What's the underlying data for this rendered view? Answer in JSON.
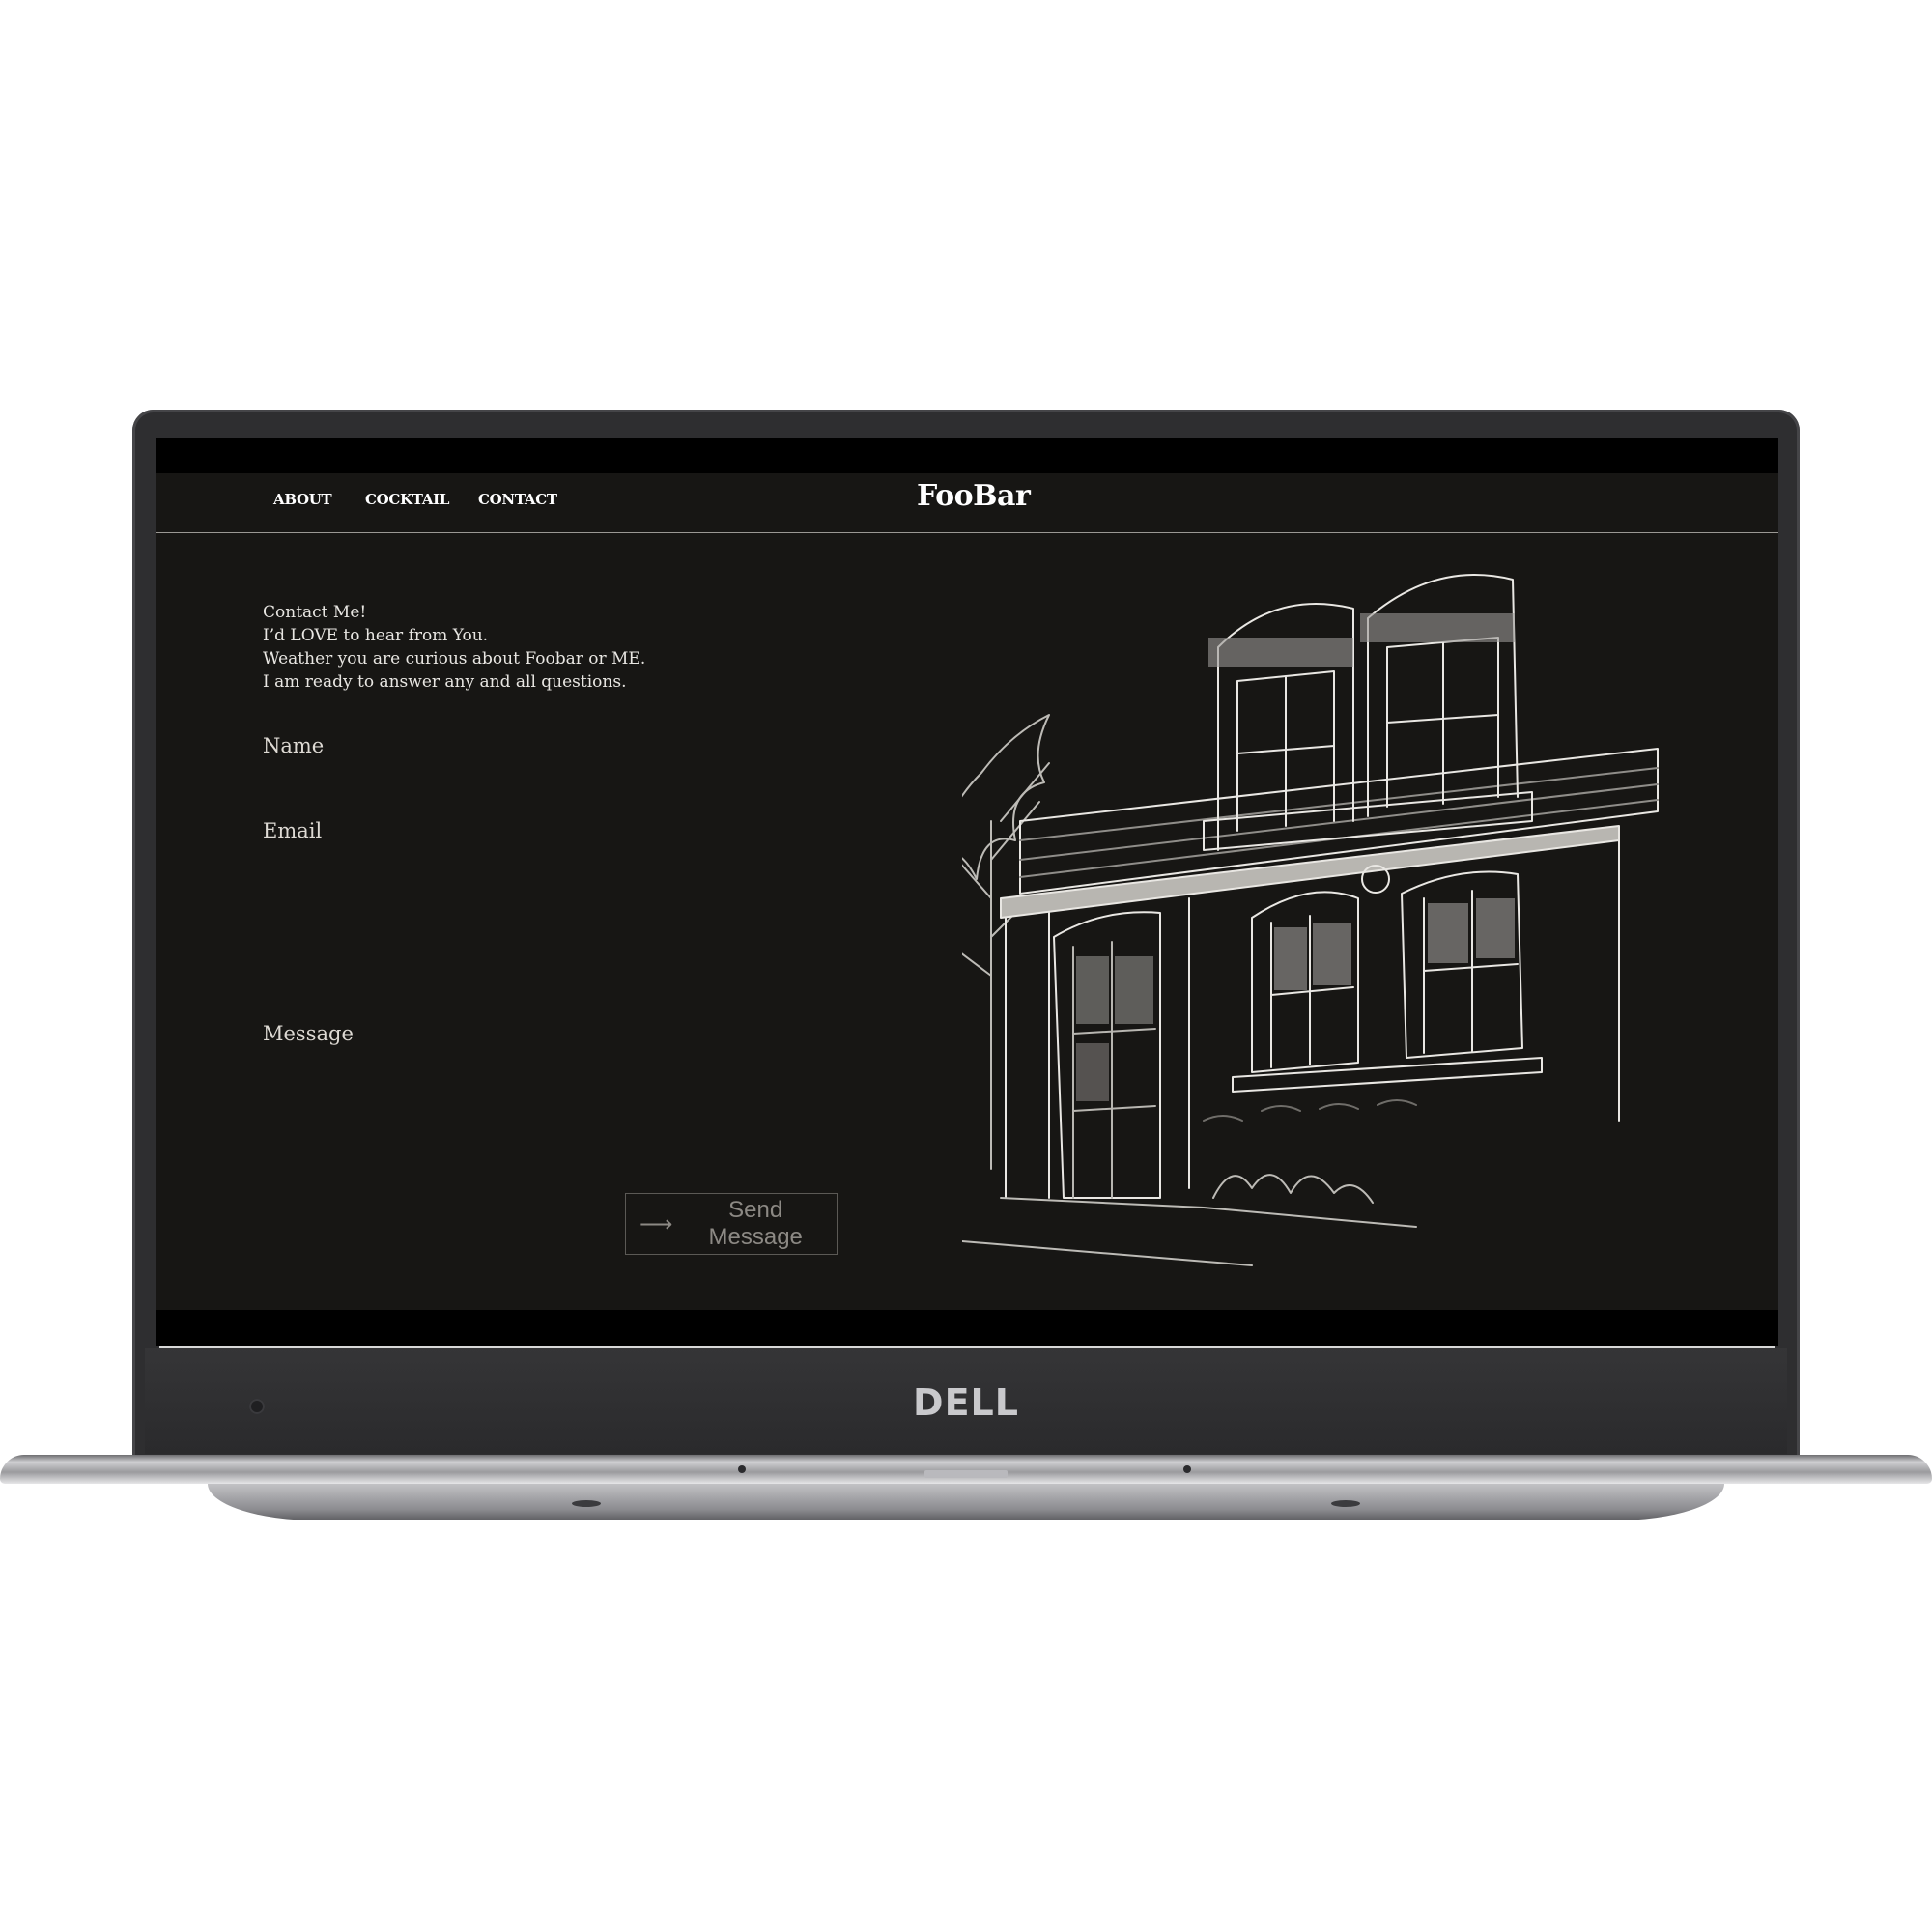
{
  "device": {
    "brand": "DELL"
  },
  "nav": {
    "items": [
      "ABOUT",
      "COCKTAIL",
      "CONTACT"
    ],
    "logo": "FooBar"
  },
  "contact": {
    "intro_lines": [
      "Contact Me!",
      "I’d LOVE to hear from You.",
      "Weather you are curious about Foobar or ME.",
      "I am ready to answer any and all questions."
    ],
    "fields": {
      "name_label": "Name",
      "email_label": "Email",
      "message_label": "Message"
    },
    "submit_label": "Send Message"
  },
  "icons": {
    "submit": "arrow-right-icon",
    "illustration": "storefront-sketch"
  },
  "colors": {
    "page_bg": "#171614",
    "text": "#e8e6e2",
    "muted": "#8c8984"
  }
}
